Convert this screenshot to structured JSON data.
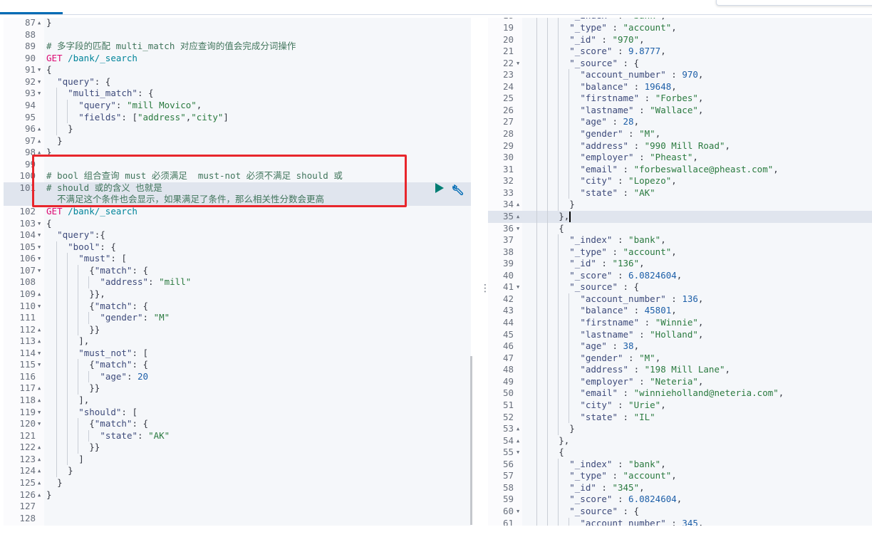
{
  "colors": {
    "accent": "#006bb4",
    "highlight_box": "#e8262c",
    "run_button": "#017d73",
    "string": "#2a7a3f",
    "key": "#3d4a7a",
    "number": "#1d5fa8",
    "comment": "#41755c",
    "method": "#dd0a73"
  },
  "request_editor": {
    "run_icon": "play-icon",
    "settings_icon": "wrench-icon",
    "lines": [
      {
        "n": "87",
        "fold": "up",
        "text": "}"
      },
      {
        "n": "88",
        "text": ""
      },
      {
        "n": "89",
        "text": "# 多字段的匹配 multi_match 对应查询的值会完成分词操作"
      },
      {
        "n": "90",
        "text": "GET /bank/_search"
      },
      {
        "n": "91",
        "fold": "down",
        "text": "{"
      },
      {
        "n": "92",
        "fold": "down",
        "text": "  \"query\": {"
      },
      {
        "n": "93",
        "fold": "down",
        "text": "    \"multi_match\": {"
      },
      {
        "n": "94",
        "text": "      \"query\": \"mill Movico\","
      },
      {
        "n": "95",
        "text": "      \"fields\": [\"address\",\"city\"]"
      },
      {
        "n": "96",
        "fold": "up",
        "text": "    }"
      },
      {
        "n": "97",
        "fold": "up",
        "text": "  }"
      },
      {
        "n": "98",
        "fold": "up",
        "text": "}"
      },
      {
        "n": "99",
        "text": ""
      },
      {
        "n": "100",
        "text": "# bool 组合查询 must 必须满足  must-not 必须不满足 should 或"
      },
      {
        "n": "101",
        "active": true,
        "text": "# should 或的含义 也就是",
        "cont": "  不满足这个条件也会显示，如果满足了条件，那么相关性分数会更高"
      },
      {
        "n": "102",
        "text": "GET /bank/_search"
      },
      {
        "n": "103",
        "fold": "down",
        "text": "{"
      },
      {
        "n": "104",
        "fold": "down",
        "text": "  \"query\":{"
      },
      {
        "n": "105",
        "fold": "down",
        "text": "    \"bool\": {"
      },
      {
        "n": "106",
        "fold": "down",
        "text": "      \"must\": ["
      },
      {
        "n": "107",
        "fold": "down",
        "text": "        {\"match\": {"
      },
      {
        "n": "108",
        "text": "          \"address\": \"mill\""
      },
      {
        "n": "109",
        "fold": "up",
        "text": "        }},"
      },
      {
        "n": "110",
        "fold": "down",
        "text": "        {\"match\": {"
      },
      {
        "n": "111",
        "text": "          \"gender\": \"M\""
      },
      {
        "n": "112",
        "fold": "up",
        "text": "        }}"
      },
      {
        "n": "113",
        "fold": "up",
        "text": "      ],"
      },
      {
        "n": "114",
        "fold": "down",
        "text": "      \"must_not\": ["
      },
      {
        "n": "115",
        "fold": "down",
        "text": "        {\"match\": {"
      },
      {
        "n": "116",
        "text": "          \"age\": 20"
      },
      {
        "n": "117",
        "fold": "up",
        "text": "        }}"
      },
      {
        "n": "118",
        "fold": "up",
        "text": "      ],"
      },
      {
        "n": "119",
        "fold": "down",
        "text": "      \"should\": ["
      },
      {
        "n": "120",
        "fold": "down",
        "text": "        {\"match\": {"
      },
      {
        "n": "121",
        "text": "          \"state\": \"AK\""
      },
      {
        "n": "122",
        "fold": "up",
        "text": "        }}"
      },
      {
        "n": "123",
        "fold": "up",
        "text": "      ]"
      },
      {
        "n": "124",
        "fold": "up",
        "text": "    }"
      },
      {
        "n": "125",
        "fold": "up",
        "text": "  }"
      },
      {
        "n": "126",
        "fold": "up",
        "text": "}"
      },
      {
        "n": "127",
        "text": ""
      },
      {
        "n": "128",
        "text": ""
      }
    ]
  },
  "response_viewer": {
    "lines": [
      {
        "n": "18",
        "text": "        \"_index\" : \"bank\","
      },
      {
        "n": "19",
        "text": "        \"_type\" : \"account\","
      },
      {
        "n": "20",
        "text": "        \"_id\" : \"970\","
      },
      {
        "n": "21",
        "text": "        \"_score\" : 9.8777,"
      },
      {
        "n": "22",
        "fold": "down",
        "text": "        \"_source\" : {"
      },
      {
        "n": "23",
        "text": "          \"account_number\" : 970,"
      },
      {
        "n": "24",
        "text": "          \"balance\" : 19648,"
      },
      {
        "n": "25",
        "text": "          \"firstname\" : \"Forbes\","
      },
      {
        "n": "26",
        "text": "          \"lastname\" : \"Wallace\","
      },
      {
        "n": "27",
        "text": "          \"age\" : 28,"
      },
      {
        "n": "28",
        "text": "          \"gender\" : \"M\","
      },
      {
        "n": "29",
        "text": "          \"address\" : \"990 Mill Road\","
      },
      {
        "n": "30",
        "text": "          \"employer\" : \"Pheast\","
      },
      {
        "n": "31",
        "text": "          \"email\" : \"forbeswallace@pheast.com\","
      },
      {
        "n": "32",
        "text": "          \"city\" : \"Lopezo\","
      },
      {
        "n": "33",
        "text": "          \"state\" : \"AK\""
      },
      {
        "n": "34",
        "fold": "up",
        "text": "        }"
      },
      {
        "n": "35",
        "fold": "up",
        "active": true,
        "cursor": true,
        "text": "      },"
      },
      {
        "n": "36",
        "fold": "down",
        "text": "      {"
      },
      {
        "n": "37",
        "text": "        \"_index\" : \"bank\","
      },
      {
        "n": "38",
        "text": "        \"_type\" : \"account\","
      },
      {
        "n": "39",
        "text": "        \"_id\" : \"136\","
      },
      {
        "n": "40",
        "text": "        \"_score\" : 6.0824604,"
      },
      {
        "n": "41",
        "fold": "down",
        "text": "        \"_source\" : {"
      },
      {
        "n": "42",
        "text": "          \"account_number\" : 136,"
      },
      {
        "n": "43",
        "text": "          \"balance\" : 45801,"
      },
      {
        "n": "44",
        "text": "          \"firstname\" : \"Winnie\","
      },
      {
        "n": "45",
        "text": "          \"lastname\" : \"Holland\","
      },
      {
        "n": "46",
        "text": "          \"age\" : 38,"
      },
      {
        "n": "47",
        "text": "          \"gender\" : \"M\","
      },
      {
        "n": "48",
        "text": "          \"address\" : \"198 Mill Lane\","
      },
      {
        "n": "49",
        "text": "          \"employer\" : \"Neteria\","
      },
      {
        "n": "50",
        "text": "          \"email\" : \"winnieholland@neteria.com\","
      },
      {
        "n": "51",
        "text": "          \"city\" : \"Urie\","
      },
      {
        "n": "52",
        "text": "          \"state\" : \"IL\""
      },
      {
        "n": "53",
        "fold": "up",
        "text": "        }"
      },
      {
        "n": "54",
        "fold": "up",
        "text": "      },"
      },
      {
        "n": "55",
        "fold": "down",
        "text": "      {"
      },
      {
        "n": "56",
        "text": "        \"_index\" : \"bank\","
      },
      {
        "n": "57",
        "text": "        \"_type\" : \"account\","
      },
      {
        "n": "58",
        "text": "        \"_id\" : \"345\","
      },
      {
        "n": "59",
        "text": "        \"_score\" : 6.0824604,"
      },
      {
        "n": "60",
        "fold": "down",
        "text": "        \"_source\" : {"
      },
      {
        "n": "61",
        "text": "          \"account_number\" : 345,"
      }
    ]
  }
}
